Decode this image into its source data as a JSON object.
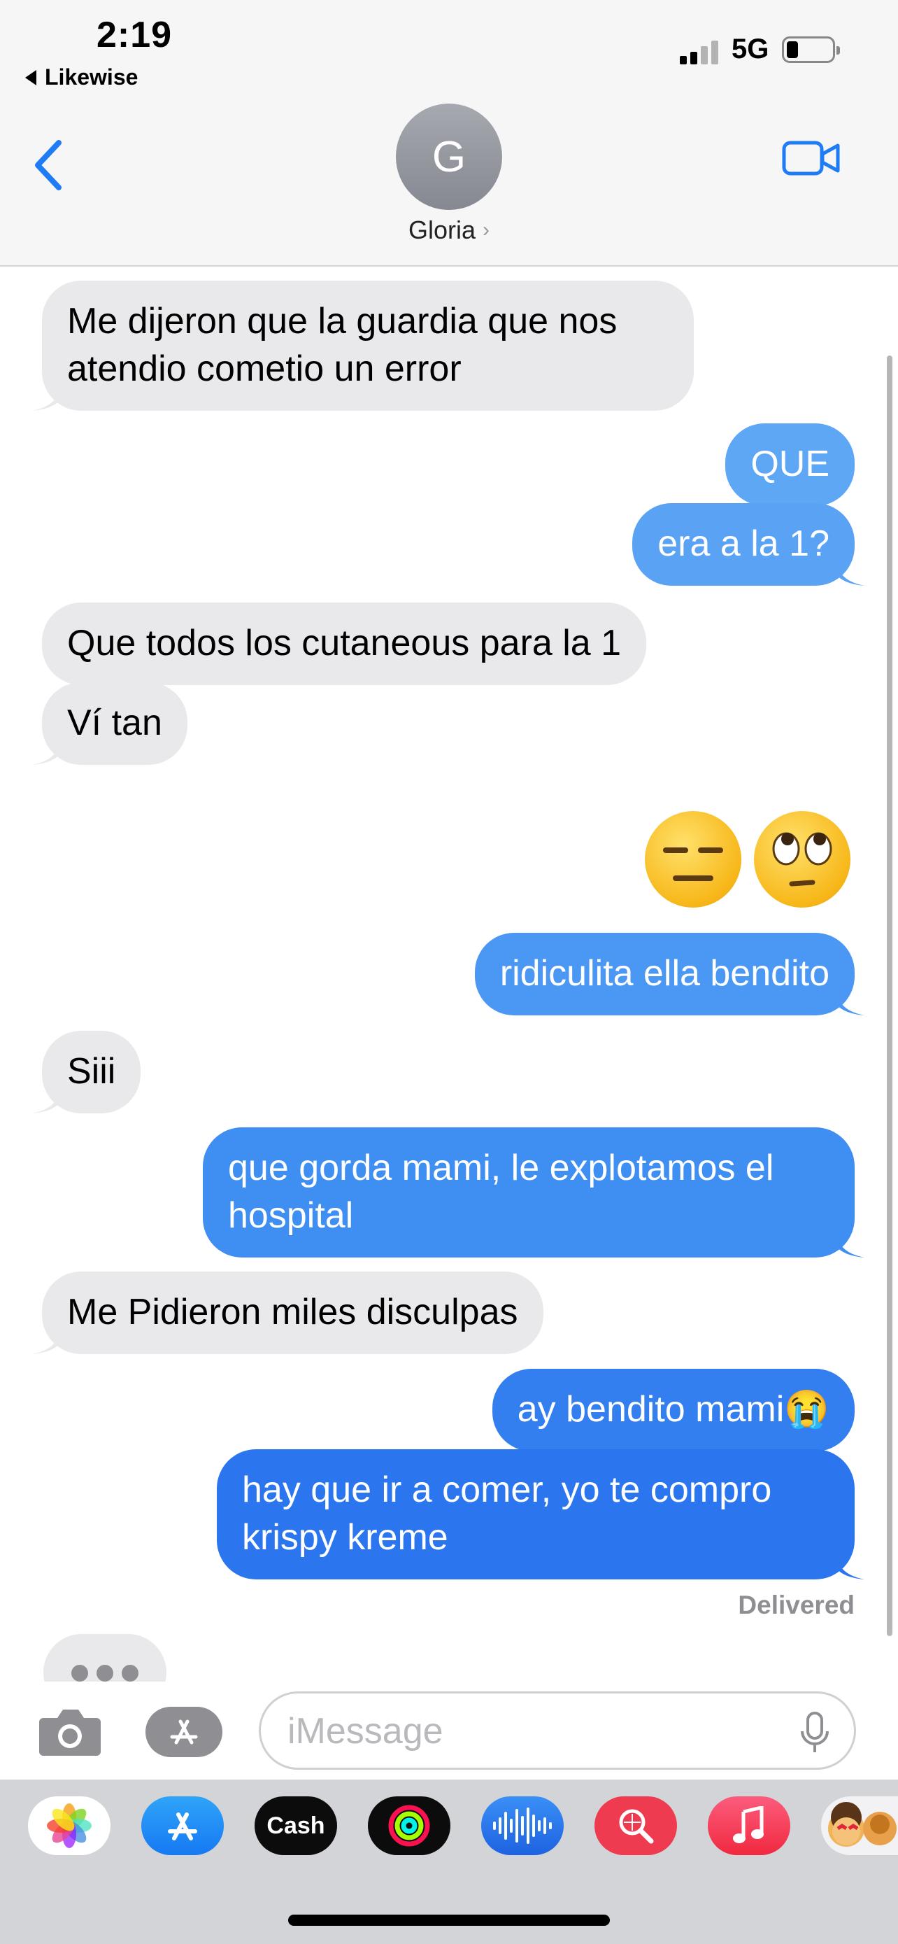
{
  "status_bar": {
    "time": "2:19",
    "back_app": "Likewise",
    "network": "5G"
  },
  "header": {
    "avatar_initial": "G",
    "contact_name": "Gloria",
    "back_icon": "chevron-left-icon",
    "video_icon": "video-camera-icon"
  },
  "messages": [
    {
      "sender": "them",
      "text": "Me dijeron que la guardia que nos atendio cometio un error"
    },
    {
      "sender": "me",
      "text": "QUE"
    },
    {
      "sender": "me",
      "text": "era a la 1?"
    },
    {
      "sender": "them",
      "text": "Que todos los cutaneous para la 1"
    },
    {
      "sender": "them",
      "text": "Ví tan"
    },
    {
      "sender": "me",
      "text": "😑🙄"
    },
    {
      "sender": "me",
      "text": "ridiculita ella bendito"
    },
    {
      "sender": "them",
      "text": "Siii"
    },
    {
      "sender": "me",
      "text": "que gorda mami, le explotamos el hospital"
    },
    {
      "sender": "them",
      "text": "Me Pidieron miles disculpas"
    },
    {
      "sender": "me",
      "text": "ay bendito mami😭"
    },
    {
      "sender": "me",
      "text": "hay que ir a comer, yo te compro krispy kreme"
    }
  ],
  "delivery_status": "Delivered",
  "composer": {
    "placeholder": "iMessage",
    "camera_icon": "camera-icon",
    "apps_icon": "app-store-icon",
    "mic_icon": "microphone-icon"
  },
  "app_drawer": {
    "apps": [
      {
        "name": "Photos",
        "icon": "photos-icon"
      },
      {
        "name": "App Store",
        "icon": "app-store-icon"
      },
      {
        "name": "Cash",
        "icon": "apple-cash-icon",
        "label": "Cash"
      },
      {
        "name": "Activity",
        "icon": "activity-rings-icon"
      },
      {
        "name": "Audio Message",
        "icon": "waveform-icon"
      },
      {
        "name": "Images",
        "icon": "image-search-icon"
      },
      {
        "name": "Music",
        "icon": "music-note-icon"
      },
      {
        "name": "Memoji",
        "icon": "memoji-icon"
      }
    ]
  },
  "colors": {
    "incoming_bubble": "#e9e9eb",
    "outgoing_light": "#5ea7f4",
    "outgoing_mid": "#3f8ef2",
    "outgoing_dark": "#2b76ee",
    "accent": "#1f7cf4",
    "header_bg": "#f6f6f6",
    "drawer_bg": "#d3d4d8"
  }
}
